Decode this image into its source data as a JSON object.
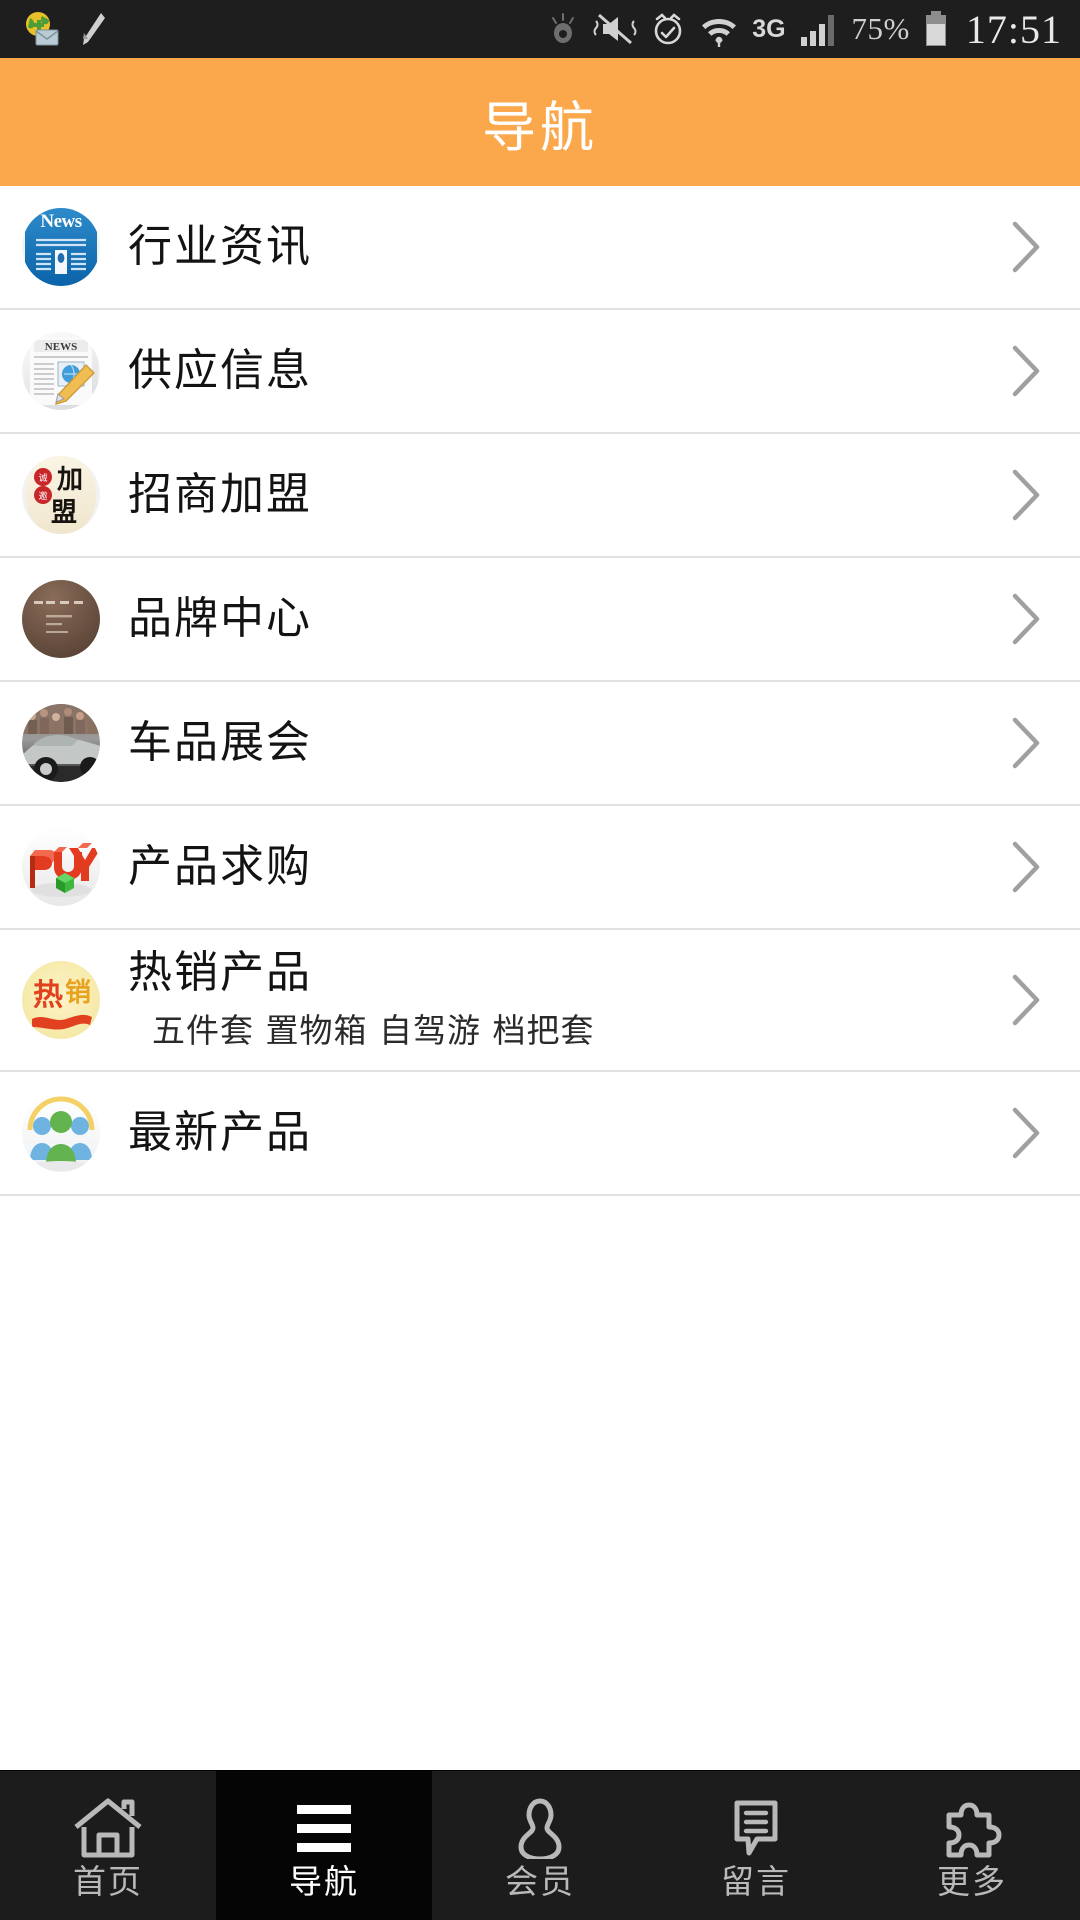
{
  "status_bar": {
    "left_icons": [
      "mail-globe-icon",
      "pencil-icon"
    ],
    "right_icons": [
      "eye-smart-stay-icon",
      "mute-vibrate-icon",
      "alarm-icon",
      "wifi-icon",
      "signal-bars-icon"
    ],
    "network": "3G",
    "battery_percent": "75%",
    "clock": "17:51"
  },
  "header": {
    "title": "导航",
    "bg_color": "#fba84c",
    "text_color": "#ffffff"
  },
  "list": {
    "chevron": "›",
    "items": [
      {
        "label": "行业资讯",
        "icon": "news-paper-blue-icon",
        "sub": ""
      },
      {
        "label": "供应信息",
        "icon": "newspaper-pencil-icon",
        "sub": ""
      },
      {
        "label": "招商加盟",
        "icon": "jiameng-seal-icon",
        "sub": ""
      },
      {
        "label": "品牌中心",
        "icon": "brand-plaque-icon",
        "sub": ""
      },
      {
        "label": "车品展会",
        "icon": "car-expo-photo-icon",
        "sub": ""
      },
      {
        "label": "产品求购",
        "icon": "buy-3d-icon",
        "sub": ""
      },
      {
        "label": "热销产品",
        "icon": "hot-sale-icon",
        "sub": "五件套  置物箱  自驾游  档把套"
      },
      {
        "label": "最新产品",
        "icon": "people-group-icon",
        "sub": ""
      }
    ]
  },
  "tabbar": {
    "active_index": 1,
    "items": [
      {
        "label": "首页",
        "icon": "home-icon"
      },
      {
        "label": "导航",
        "icon": "hamburger-menu-icon"
      },
      {
        "label": "会员",
        "icon": "person-icon"
      },
      {
        "label": "留言",
        "icon": "comment-bubble-icon"
      },
      {
        "label": "更多",
        "icon": "puzzle-piece-icon"
      }
    ]
  }
}
